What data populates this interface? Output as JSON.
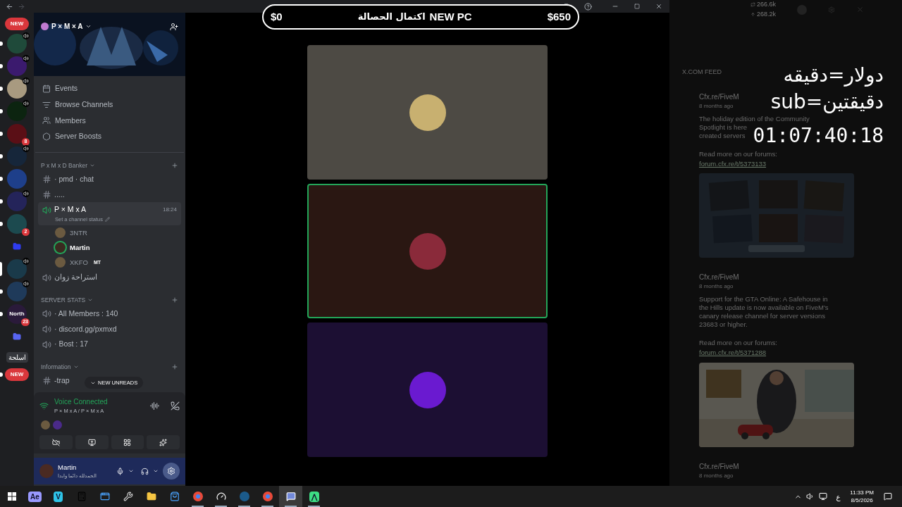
{
  "goal_overlay": {
    "start": "$0",
    "title": "اكتمال الحصالة",
    "subtitle": "NEW PC",
    "end": "$650"
  },
  "stream_overlay": {
    "lines": [
      "دولار=دقيقه",
      "sub=دقيقتين"
    ],
    "timer": "01:07:40:18"
  },
  "server_rail": [
    {
      "kind": "pill",
      "label": "NEW"
    },
    {
      "kind": "server",
      "color": "#1f4a3a",
      "voice": true,
      "unread": true
    },
    {
      "kind": "server",
      "color": "#3b1a6e",
      "voice": true,
      "unread": true
    },
    {
      "kind": "server",
      "color": "#a89a80",
      "voice": true,
      "unread": true
    },
    {
      "kind": "server",
      "color": "#0c2410",
      "voice": true,
      "unread": true
    },
    {
      "kind": "server",
      "color": "#5a0f16",
      "badge": "8",
      "unread": true
    },
    {
      "kind": "server",
      "color": "#16263a",
      "voice": true,
      "unread": true
    },
    {
      "kind": "server",
      "color": "#1e3f8a",
      "unread": true
    },
    {
      "kind": "server",
      "color": "#24245a",
      "voice": true,
      "unread": true
    },
    {
      "kind": "server",
      "color": "#1c4a4f",
      "badge": "2",
      "unread": true
    },
    {
      "kind": "folder",
      "color": "#2f3cf0"
    },
    {
      "kind": "server",
      "color": "#1a3a4a",
      "voice": true,
      "selected": true
    },
    {
      "kind": "server",
      "color": "#1f3a5a",
      "voice": true,
      "unread": true
    },
    {
      "kind": "server",
      "color": "#2a1a3a",
      "label": "North",
      "badge": "23",
      "unread": true
    },
    {
      "kind": "folder",
      "color": "#5865f2"
    },
    {
      "kind": "label",
      "label": "اسلحة"
    },
    {
      "kind": "pill",
      "label": "NEW",
      "unread": true
    }
  ],
  "server": {
    "name": "P × M × A",
    "menu": [
      "Events",
      "Browse Channels",
      "Members",
      "Server Boosts"
    ]
  },
  "categories": [
    {
      "name": "P x M x D Banker",
      "channels": [
        {
          "kind": "text",
          "name": "· pmd · chat"
        },
        {
          "kind": "text",
          "name": "....."
        },
        {
          "kind": "voice",
          "name": "P × M x A",
          "selected": true,
          "time": "18:24",
          "status": "Set a channel status",
          "members": [
            {
              "name": "3NTR",
              "speaking": false
            },
            {
              "name": "Martin",
              "speaking": true
            },
            {
              "name": "XKFO",
              "speaking": false,
              "tag": "MT"
            }
          ]
        },
        {
          "kind": "voice",
          "name": "استراحة زوان"
        }
      ]
    },
    {
      "name": "SERVER STATS",
      "channels": [
        {
          "kind": "voice",
          "name": "· All Members : 140"
        },
        {
          "kind": "voice",
          "name": "· discord.gg/pxmxd"
        },
        {
          "kind": "voice",
          "name": "· Bost : 17"
        }
      ]
    },
    {
      "name": "Information",
      "channels": [
        {
          "kind": "text",
          "name": "-trap"
        }
      ]
    }
  ],
  "new_unreads": "NEW UNREADS",
  "voice_panel": {
    "status": "Voice Connected",
    "channel": "P × M x A / P × M x A"
  },
  "user_panel": {
    "name": "Martin",
    "status": "الحمدلله دائما وابدا"
  },
  "tiles": [
    {
      "color": "#4d4a44",
      "speaking": false
    },
    {
      "color": "#2a1712",
      "speaking": true
    },
    {
      "color": "#1c0f33",
      "speaking": false
    }
  ],
  "feed": {
    "stats": [
      "266.6k",
      "268.2k"
    ],
    "title": "X.COM FEED",
    "posts": [
      {
        "author": "Cfx.re/FiveM",
        "time": "8 months ago",
        "lines": [
          "The holiday edition of the Community",
          "Spotlight is here",
          "created servers"
        ],
        "more": "Read more on our forums:",
        "link": "forum.cfx.re/t/5373133",
        "media": {
          "kind": "picture"
        }
      },
      {
        "author": "Cfx.re/FiveM",
        "time": "8 months ago",
        "lines": [
          "Support for the GTA Online: A Safehouse in",
          "the Hills update is now available on FiveM's",
          "canary release channel for server versions",
          "23683 or higher."
        ],
        "more": "Read more on our forums:",
        "link": "forum.cfx.re/t/5371288",
        "media": {
          "kind": "picture"
        }
      },
      {
        "author": "Cfx.re/FiveM",
        "time": "8 months ago"
      }
    ]
  },
  "taskbar": {
    "apps": [
      {
        "kind": "logo",
        "label": "Ae",
        "color": "#9999ff",
        "active": false
      },
      {
        "kind": "logo",
        "label": "V",
        "color": "#2ec4e8",
        "active": false
      },
      {
        "kind": "calculator",
        "active": false
      },
      {
        "kind": "window",
        "active": false
      },
      {
        "kind": "wrench",
        "active": false
      },
      {
        "kind": "folder",
        "active": false
      },
      {
        "kind": "store",
        "active": false
      },
      {
        "kind": "chrome",
        "active": true
      },
      {
        "kind": "gauge",
        "active": true
      },
      {
        "kind": "steam",
        "active": true
      },
      {
        "kind": "chrome",
        "active": true
      },
      {
        "kind": "discord",
        "active": true,
        "selected": true
      },
      {
        "kind": "logo",
        "label": "⋀",
        "color": "#3ddc84",
        "active": true
      }
    ],
    "lang": "ع",
    "time": "11:33 PM",
    "date": "8/5/2026"
  }
}
